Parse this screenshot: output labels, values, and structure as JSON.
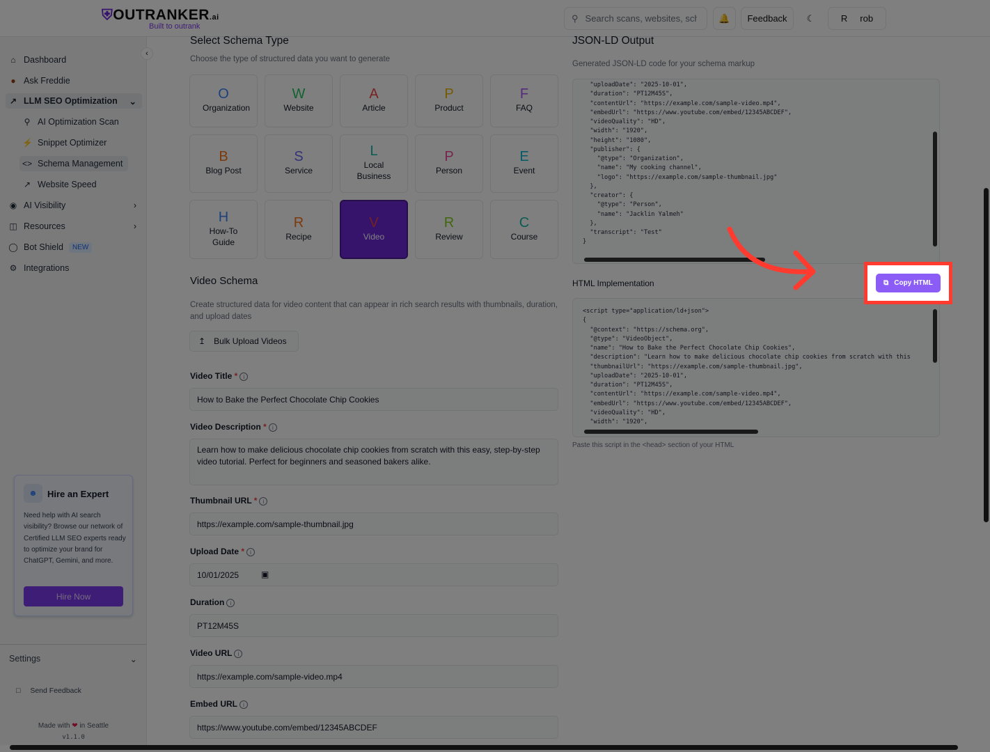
{
  "brand": {
    "name": "OUTRANKER",
    "suffix": ".ai",
    "tagline": "Built to outrank"
  },
  "header": {
    "search_placeholder": "Search scans, websites, schemas",
    "feedback": "Feedback",
    "avatar_initial": "R",
    "user": "rob"
  },
  "sidebar": {
    "items": [
      {
        "label": "Dashboard",
        "icon": "home-icon"
      },
      {
        "label": "Ask Freddie",
        "icon": "avatar"
      },
      {
        "label": "LLM SEO Optimization",
        "icon": "trend-icon"
      },
      {
        "label": "AI Optimization Scan",
        "icon": "search-icon"
      },
      {
        "label": "Snippet Optimizer",
        "icon": "bolt-icon"
      },
      {
        "label": "Schema Management",
        "icon": "code-icon"
      },
      {
        "label": "Website Speed",
        "icon": "trend-icon"
      },
      {
        "label": "AI Visibility",
        "icon": "eye-icon"
      },
      {
        "label": "Resources",
        "icon": "book-icon"
      },
      {
        "label": "Bot Shield",
        "icon": "shield-icon",
        "badge": "NEW"
      },
      {
        "label": "Integrations",
        "icon": "gear-icon"
      }
    ],
    "card": {
      "title": "Hire an Expert",
      "text": "Need help with AI search visibility? Browse our network of Certified LLM SEO experts ready to optimize your brand for ChatGPT, Gemini, and more.",
      "button": "Hire Now"
    },
    "settings": "Settings",
    "send_feedback": "Send Feedback",
    "made_with": "Made with",
    "in_city": "in Seattle",
    "version": "v1.1.0"
  },
  "schema": {
    "title": "Select Schema Type",
    "subtitle": "Choose the type of structured data you want to generate",
    "types": [
      {
        "letter": "O",
        "label": "Organization",
        "color": "#3b82f6"
      },
      {
        "letter": "W",
        "label": "Website",
        "color": "#22c55e"
      },
      {
        "letter": "A",
        "label": "Article",
        "color": "#ef4444"
      },
      {
        "letter": "P",
        "label": "Product",
        "color": "#eab308"
      },
      {
        "letter": "F",
        "label": "FAQ",
        "color": "#a855f7"
      },
      {
        "letter": "B",
        "label": "Blog Post",
        "color": "#f97316"
      },
      {
        "letter": "S",
        "label": "Service",
        "color": "#6366f1"
      },
      {
        "letter": "L",
        "label": "Local Business",
        "color": "#14b8a6"
      },
      {
        "letter": "P",
        "label": "Person",
        "color": "#ec4899"
      },
      {
        "letter": "E",
        "label": "Event",
        "color": "#06b6d4"
      },
      {
        "letter": "H",
        "label": "How-To Guide",
        "color": "#3b82f6"
      },
      {
        "letter": "R",
        "label": "Recipe",
        "color": "#f97316"
      },
      {
        "letter": "V",
        "label": "Video",
        "color": "#ef4444",
        "selected": true
      },
      {
        "letter": "R",
        "label": "Review",
        "color": "#84cc16"
      },
      {
        "letter": "C",
        "label": "Course",
        "color": "#14b8a6"
      }
    ]
  },
  "video": {
    "title": "Video Schema",
    "description": "Create structured data for video content that can appear in rich search results with thumbnails, duration, and upload dates",
    "bulk": "Bulk Upload Videos",
    "fields": [
      {
        "label": "Video Title",
        "required": true,
        "value": "How to Bake the Perfect Chocolate Chip Cookies"
      },
      {
        "label": "Video Description",
        "required": true,
        "value": "Learn how to make delicious chocolate chip cookies from scratch with this easy, step-by-step video tutorial. Perfect for beginners and seasoned bakers alike."
      },
      {
        "label": "Thumbnail URL",
        "required": true,
        "value": "https://example.com/sample-thumbnail.jpg"
      },
      {
        "label": "Upload Date",
        "required": true,
        "value": "10/01/2025"
      },
      {
        "label": "Duration",
        "required": false,
        "value": "PT12M45S"
      },
      {
        "label": "Video URL",
        "required": false,
        "value": "https://example.com/sample-video.mp4"
      },
      {
        "label": "Embed URL",
        "required": false,
        "value": "https://www.youtube.com/embed/12345ABCDEF"
      }
    ]
  },
  "output": {
    "title": "JSON-LD Output",
    "subtitle": "Generated JSON-LD code for your schema markup",
    "json_lines": [
      "  \"uploadDate\": \"2025-10-01\",",
      "  \"duration\": \"PT12M45S\",",
      "  \"contentUrl\": \"https://example.com/sample-video.mp4\",",
      "  \"embedUrl\": \"https://www.youtube.com/embed/12345ABCDEF\",",
      "  \"videoQuality\": \"HD\",",
      "  \"width\": \"1920\",",
      "  \"height\": \"1080\",",
      "  \"publisher\": {",
      "    \"@type\": \"Organization\",",
      "    \"name\": \"My cooking channel\",",
      "    \"logo\": \"https://example.com/sample-thumbnail.jpg\"",
      "  },",
      "  \"creator\": {",
      "    \"@type\": \"Person\",",
      "    \"name\": \"Jacklin Yalmeh\"",
      "  },",
      "  \"transcript\": \"Test\"",
      "}"
    ],
    "html_title": "HTML Implementation",
    "copy": "Copy HTML",
    "html_lines": [
      "<script type=\"application/ld+json\">",
      "{",
      "  \"@context\": \"https://schema.org\",",
      "  \"@type\": \"VideoObject\",",
      "  \"name\": \"How to Bake the Perfect Chocolate Chip Cookies\",",
      "  \"description\": \"Learn how to make delicious chocolate chip cookies from scratch with this",
      "  \"thumbnailUrl\": \"https://example.com/sample-thumbnail.jpg\",",
      "  \"uploadDate\": \"2025-10-01\",",
      "  \"duration\": \"PT12M45S\",",
      "  \"contentUrl\": \"https://example.com/sample-video.mp4\",",
      "  \"embedUrl\": \"https://www.youtube.com/embed/12345ABCDEF\",",
      "  \"videoQuality\": \"HD\",",
      "  \"width\": \"1920\","
    ],
    "note": "Paste this script in the <head> section of your HTML"
  },
  "colors": {
    "accent": "#7c3aed",
    "highlight": "#ff3b30"
  }
}
